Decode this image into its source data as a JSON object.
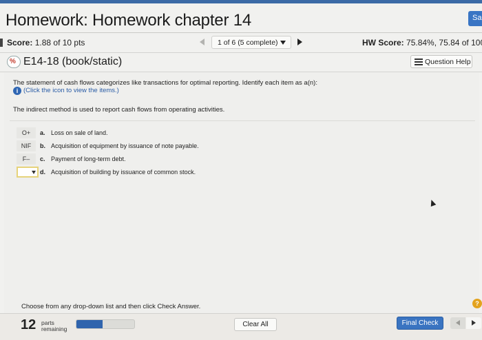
{
  "header": {
    "title": "Homework: Homework chapter 14",
    "save_label": "Sa"
  },
  "score_bar": {
    "score_label": "Score:",
    "score_value": "1.88 of 10 pts",
    "pager_text": "1 of 6 (5 complete)",
    "hw_score_label": "HW Score:",
    "hw_score_value": "75.84%, 75.84 of 100"
  },
  "question": {
    "id": "E14-18 (book/static)",
    "help_label": "Question Help",
    "instruction": "The statement of cash flows categorizes like transactions for optimal reporting. Identify each item as a(n):",
    "info_link": "(Click the icon to view the items.)",
    "method_note": "The indirect method is used to report cash flows from operating activities.",
    "items": [
      {
        "answer": "O+",
        "letter": "a.",
        "text": "Loss on sale of land."
      },
      {
        "answer": "NIF",
        "letter": "b.",
        "text": "Acquisition of equipment by issuance of note payable."
      },
      {
        "answer": "F–",
        "letter": "c.",
        "text": "Payment of long-term debt."
      },
      {
        "answer": "",
        "letter": "d.",
        "text": "Acquisition of building by issuance of common stock."
      }
    ]
  },
  "footer": {
    "instruction": "Choose from any drop-down list and then click Check Answer.",
    "help_mark": "?",
    "parts_count": "12",
    "parts_label": "parts remaining",
    "progress_fraction": 0.45,
    "clear_label": "Clear All",
    "final_label": "Final Check"
  }
}
